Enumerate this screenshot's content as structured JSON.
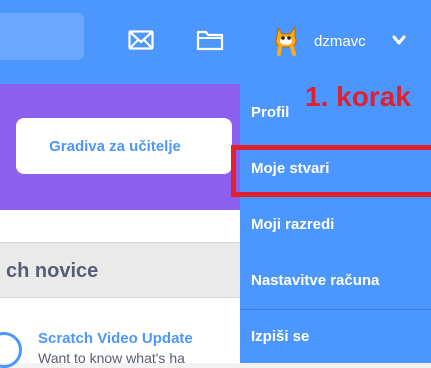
{
  "header": {
    "username": "dzmavc",
    "icons": [
      "mail-icon",
      "folder-icon",
      "scratch-cat-avatar",
      "chevron-down-icon"
    ]
  },
  "banner": {
    "button_label": "Gradiva za učitelje"
  },
  "news": {
    "title": "ch novice",
    "item_title": "Scratch Video Update",
    "item_text": "Want to know what's ha"
  },
  "dropdown": {
    "items": [
      "Profil",
      "Moje stvari",
      "Moji razredi",
      "Nastavitve računa",
      "Izpiši se"
    ]
  },
  "annotation": {
    "step_label": "1. korak",
    "color": "#e0202e"
  },
  "colors": {
    "topbar": "#4c97ff",
    "banner": "#8c5fee",
    "accent_text": "#4c97ff"
  }
}
